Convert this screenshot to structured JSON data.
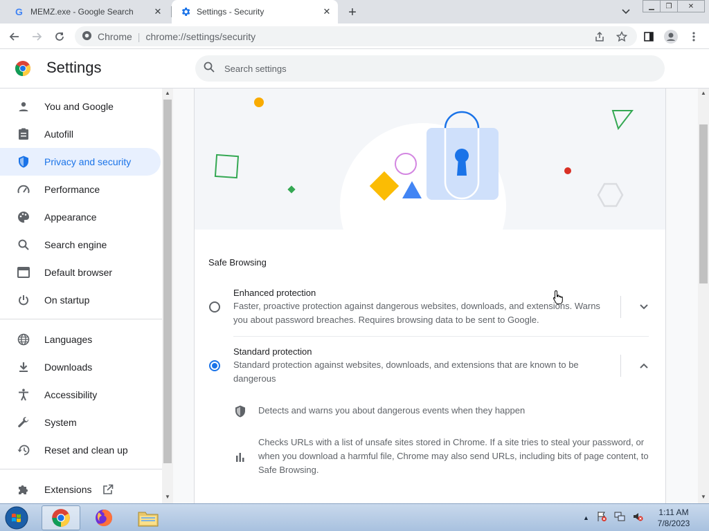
{
  "tabs": [
    {
      "title": "MEMZ.exe - Google Search",
      "icon": "google-g-icon"
    },
    {
      "title": "Settings - Security",
      "icon": "settings-gear-icon"
    }
  ],
  "toolbar": {
    "site_label": "Chrome",
    "url": "chrome://settings/security"
  },
  "header": {
    "title": "Settings",
    "search_placeholder": "Search settings"
  },
  "sidebar": {
    "items": [
      {
        "label": "You and Google",
        "icon": "person-icon"
      },
      {
        "label": "Autofill",
        "icon": "clipboard-icon"
      },
      {
        "label": "Privacy and security",
        "icon": "shield-icon",
        "active": true
      },
      {
        "label": "Performance",
        "icon": "speedometer-icon"
      },
      {
        "label": "Appearance",
        "icon": "palette-icon"
      },
      {
        "label": "Search engine",
        "icon": "search-icon"
      },
      {
        "label": "Default browser",
        "icon": "browser-window-icon"
      },
      {
        "label": "On startup",
        "icon": "power-icon"
      },
      {
        "label": "Languages",
        "icon": "globe-icon"
      },
      {
        "label": "Downloads",
        "icon": "download-icon"
      },
      {
        "label": "Accessibility",
        "icon": "accessibility-icon"
      },
      {
        "label": "System",
        "icon": "wrench-icon"
      },
      {
        "label": "Reset and clean up",
        "icon": "history-icon"
      },
      {
        "label": "Extensions",
        "icon": "puzzle-icon"
      }
    ]
  },
  "main": {
    "section_label": "Safe Browsing",
    "options": [
      {
        "title": "Enhanced protection",
        "desc": "Faster, proactive protection against dangerous websites, downloads, and extensions. Warns you about password breaches. Requires browsing data to be sent to Google.",
        "selected": false
      },
      {
        "title": "Standard protection",
        "desc": "Standard protection against websites, downloads, and extensions that are known to be dangerous",
        "selected": true
      }
    ],
    "details": [
      {
        "icon": "shield-icon",
        "text": "Detects and warns you about dangerous events when they happen"
      },
      {
        "icon": "bar-chart-icon",
        "text": "Checks URLs with a list of unsafe sites stored in Chrome. If a site tries to steal your password, or when you download a harmful file, Chrome may also send URLs, including bits of page content, to Safe Browsing."
      }
    ]
  },
  "taskbar": {
    "time": "1:11 AM",
    "date": "7/8/2023"
  },
  "colors": {
    "accent": "#1a73e8",
    "active_nav_bg": "#e8f0fe"
  }
}
